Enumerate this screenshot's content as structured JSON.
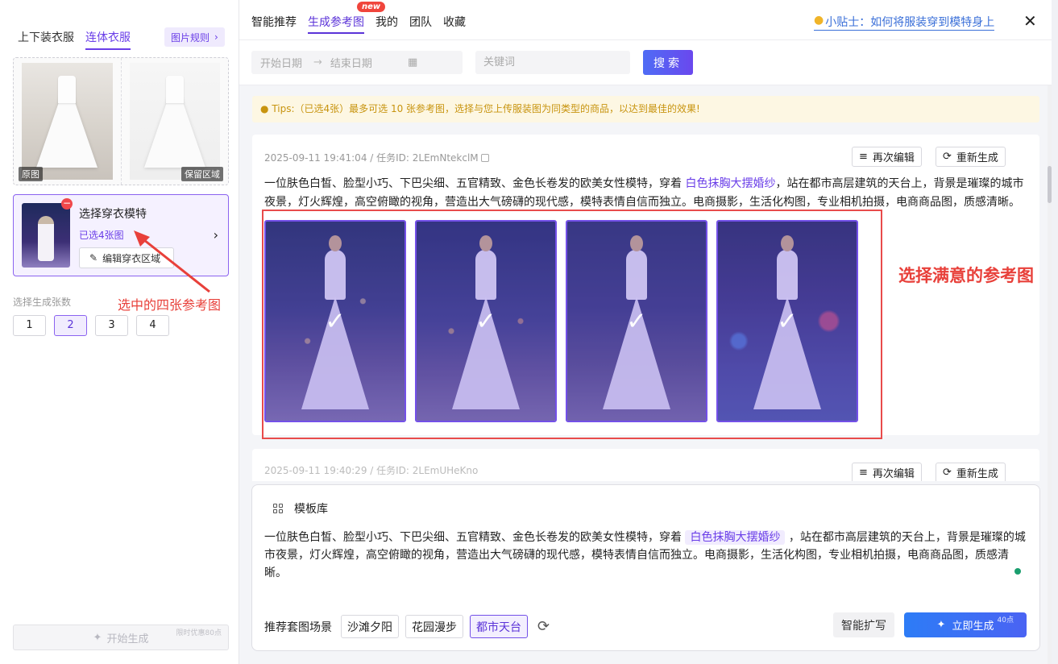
{
  "left": {
    "tabs": [
      "上下装衣服",
      "连体衣服"
    ],
    "rules_btn": "图片规则",
    "garment_tags": [
      "原图",
      "保留区域"
    ],
    "model_card": {
      "title": "选择穿衣模特",
      "subtitle": "已选4张图",
      "edit_btn": "编辑穿衣区域"
    },
    "gen_count_label": "选择生成张数",
    "counts": [
      "1",
      "2",
      "3",
      "4"
    ],
    "selected_count": "2",
    "annotation": "选中的四张参考图",
    "start_btn": "开始生成",
    "promo": "限时优惠80点"
  },
  "nav": {
    "tabs": [
      "智能推荐",
      "生成参考图",
      "我的",
      "团队",
      "收藏"
    ],
    "active_tab": "生成参考图",
    "new_badge": "new",
    "tip_link": "小贴士：如何将服装穿到模特身上"
  },
  "filters": {
    "start_date_placeholder": "开始日期",
    "end_date_placeholder": "结束日期",
    "keyword_placeholder": "关键词",
    "search_btn": "搜索"
  },
  "tips": "Tips:（已选4张）最多可选 10 张参考图，选择与您上传服装图为同类型的商品，以达到最佳的效果!",
  "task": {
    "meta": "2025-09-11 19:41:04 / 任务ID: 2LEmNtekclM",
    "re_edit": "再次编辑",
    "regenerate": "重新生成",
    "prompt_before": "一位肤色白皙、脸型小巧、下巴尖细、五官精致、金色长卷发的欧美女性模特，穿着 ",
    "prompt_highlight": "白色抹胸大摆婚纱",
    "prompt_after": "，站在都市高层建筑的天台上，背景是璀璨的城市夜景，灯火辉煌，高空俯瞰的视角，营造出大气磅礴的现代感，模特表情自信而独立。电商摄影，生活化构图，专业相机拍摄，电商商品图，质感清晰。",
    "images_selected": 4
  },
  "annotation_right": "选择满意的参考图",
  "task2": {
    "meta": "2025-09-11 19:40:29 / 任务ID: 2LEmUHeKno",
    "re_edit": "再次编辑",
    "regenerate": "重新生成"
  },
  "composer": {
    "template_lib": "模板库",
    "text_before": "一位肤色白皙、脸型小巧、下巴尖细、五官精致、金色长卷发的欧美女性模特，穿着 ",
    "text_chip": "白色抹胸大摆婚纱",
    "text_after": " ，站在都市高层建筑的天台上，背景是璀璨的城市夜景，灯火辉煌，高空俯瞰的视角，营造出大气磅礴的现代感，模特表情自信而独立。电商摄影，生活化构图，专业相机拍摄，电商商品图，质感清晰。",
    "scene_label": "推荐套图场景",
    "scenes": [
      "沙滩夕阳",
      "花园漫步",
      "都市天台"
    ],
    "active_scene": "都市天台",
    "expand_btn": "智能扩写",
    "generate_btn": "立即生成",
    "cost": "40点"
  },
  "colors": {
    "accent": "#6a3ee8",
    "annotation": "#e8403a",
    "primary_btn": "#2d7cf6"
  }
}
